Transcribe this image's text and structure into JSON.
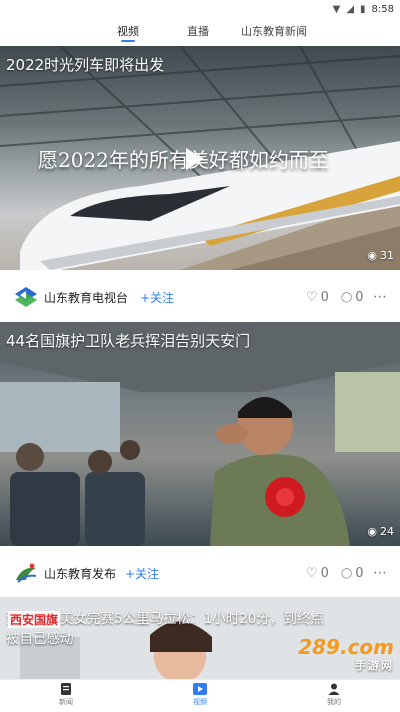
{
  "status_bar": {
    "time": "8:58"
  },
  "tabs": [
    {
      "label": "视频",
      "active": true
    },
    {
      "label": "直播",
      "active": false
    },
    {
      "label": "山东教育新闻",
      "active": false
    }
  ],
  "feed": [
    {
      "title": "2022时光列车即将出发",
      "overlay_text": "愿2022年的所有美好都如约而至",
      "views": "31",
      "channel": "山东教育电视台",
      "follow_label": "+关注",
      "likes": "0",
      "comments": "0"
    },
    {
      "title": "44名国旗护卫队老兵挥泪告别天安门",
      "views": "24",
      "channel": "山东教育发布",
      "follow_label": "+关注",
      "likes": "0",
      "comments": "0"
    },
    {
      "title_line1": "河北肥胖美女完赛5公里马拉松：1小时20分，到终点",
      "title_line2": "被自己感动",
      "overlay_text": "西安国旗"
    }
  ],
  "watermark": {
    "brand": "289.com",
    "sub": "手游网"
  },
  "bottom_nav": [
    {
      "label": "新闻",
      "icon": "news-icon",
      "active": false
    },
    {
      "label": "视频",
      "icon": "video-icon",
      "active": true
    },
    {
      "label": "我的",
      "icon": "user-icon",
      "active": false
    }
  ],
  "colors": {
    "accent": "#2f7cf6",
    "text": "#222222",
    "muted": "#777777"
  }
}
